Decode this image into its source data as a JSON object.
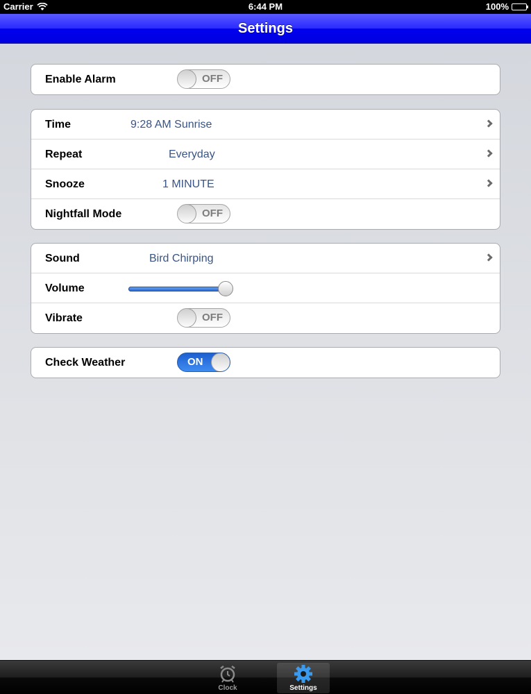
{
  "status_bar": {
    "carrier": "Carrier",
    "time": "6:44 PM",
    "battery": "100%"
  },
  "nav": {
    "title": "Settings"
  },
  "groups": {
    "alarm": {
      "enable_label": "Enable Alarm",
      "enable_state": "OFF"
    },
    "schedule": {
      "time_label": "Time",
      "time_value": "9:28 AM Sunrise",
      "repeat_label": "Repeat",
      "repeat_value": "Everyday",
      "snooze_label": "Snooze",
      "snooze_value": "1 MINUTE",
      "nightfall_label": "Nightfall Mode",
      "nightfall_state": "OFF"
    },
    "sound": {
      "sound_label": "Sound",
      "sound_value": "Bird Chirping",
      "volume_label": "Volume",
      "volume_level": 0.93,
      "vibrate_label": "Vibrate",
      "vibrate_state": "OFF"
    },
    "weather": {
      "check_weather_label": "Check Weather",
      "check_weather_state": "ON"
    }
  },
  "tab_bar": {
    "tabs": [
      {
        "label": "Clock",
        "icon": "alarm-clock-icon",
        "selected": false
      },
      {
        "label": "Settings",
        "icon": "gear-icon",
        "selected": true
      }
    ]
  },
  "colors": {
    "nav_bar": "#0000ee",
    "value_text": "#385487",
    "toggle_on": "#2d6ad3"
  }
}
